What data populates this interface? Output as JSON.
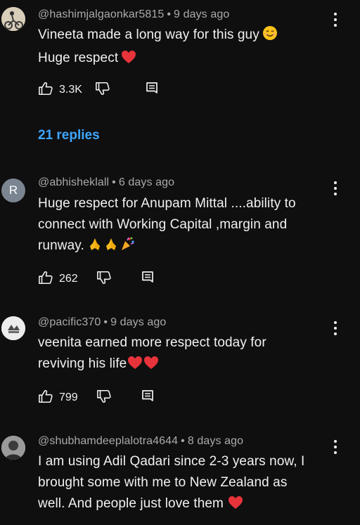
{
  "comments": [
    {
      "author": "@hashimjalgaonkar5815",
      "time": "9 days ago",
      "lines": [
        "Vineeta made a long way for this guy",
        "Huge respect"
      ],
      "likes": "3.3K",
      "replies_label": "21 replies",
      "avatar_type": "image"
    },
    {
      "author": "@abhisheklall",
      "time": "6 days ago",
      "avatar_letter": "R",
      "lines": [
        "Huge respect for Anupam Mittal ....ability to",
        "connect with Working Capital ,margin and",
        "runway."
      ],
      "likes": "262"
    },
    {
      "author": "@pacific370",
      "time": "9 days ago",
      "lines": [
        "veenita earned more respect today for",
        "reviving his life"
      ],
      "likes": "799",
      "avatar_type": "image"
    },
    {
      "author": "@shubhamdeeplalotra4644",
      "time": "8 days ago",
      "lines": [
        "I am using Adil Qadari since 2-3 years now, I",
        "brought some with me to New Zealand as",
        "well. And people just love them"
      ],
      "avatar_type": "image"
    }
  ],
  "separator": "•",
  "colors": {
    "background": "#0f0f0f",
    "text": "#f1f1f1",
    "meta": "#aaaaaa",
    "link": "#3ea6ff",
    "heart": "#e8333b"
  },
  "icons": {
    "like": "thumb-up-icon",
    "dislike": "thumb-down-icon",
    "reply": "comment-reply-icon",
    "more": "more-vert-icon",
    "heart": "red-heart-emoji",
    "smile": "smiling-face-emoji",
    "pray": "folded-hands-emoji",
    "party": "party-popper-emoji"
  }
}
